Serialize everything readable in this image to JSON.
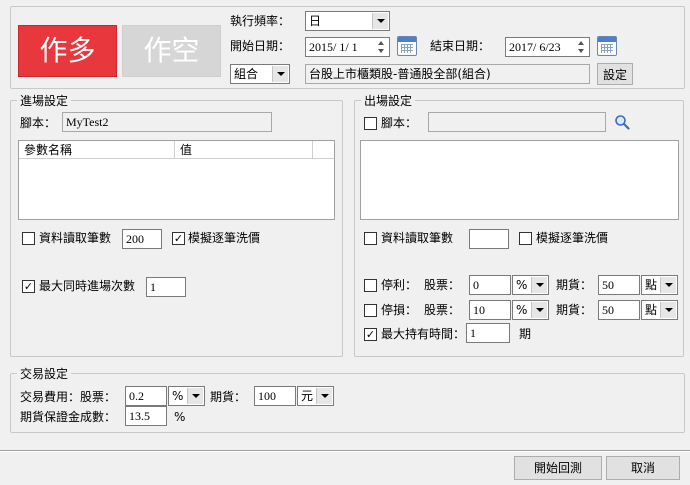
{
  "header": {
    "btn_long": "作多",
    "btn_short": "作空",
    "frequency_label": "執行頻率：",
    "frequency_value": "日",
    "start_label": "開始日期：",
    "start_value": "2015/ 1/ 1",
    "end_label": "結束日期：",
    "end_value": "2017/ 6/23",
    "scope_value": "組合",
    "scope_text": "台股上市櫃類股-普通股全部(組合)",
    "settings_btn": "設定"
  },
  "entry": {
    "title": "進場設定",
    "script_label": "腳本：",
    "script_value": "MyTest2",
    "param_col_name": "參數名稱",
    "param_col_value": "值",
    "records_label": "資料讀取筆數",
    "records_value": "200",
    "records_checked": false,
    "simulate_label": "模擬逐筆洗價",
    "simulate_checked": true,
    "max_entries_label": "最大同時進場次數",
    "max_entries_value": "1",
    "max_entries_checked": true
  },
  "exit": {
    "title": "出場設定",
    "script_label": "腳本：",
    "script_checked": false,
    "records_label": "資料讀取筆數",
    "records_checked": false,
    "simulate_label": "模擬逐筆洗價",
    "simulate_checked": false,
    "take_profit_label": "停利：",
    "take_profit_checked": false,
    "stop_loss_label": "停損：",
    "stop_loss_checked": false,
    "stock_label": "股票：",
    "futures_label": "期貨：",
    "tp_stock_value": "0",
    "tp_stock_unit": "%",
    "tp_fut_value": "50",
    "tp_fut_unit": "點",
    "sl_stock_value": "10",
    "sl_stock_unit": "%",
    "sl_fut_value": "50",
    "sl_fut_unit": "點",
    "max_hold_label": "最大持有時間：",
    "max_hold_checked": true,
    "max_hold_value": "1",
    "max_hold_unit": "期"
  },
  "trade": {
    "title": "交易設定",
    "fee_label": "交易費用：股票：",
    "fee_stock_value": "0.2",
    "fee_stock_unit": "%",
    "fee_fut_label": "期貨：",
    "fee_fut_value": "100",
    "fee_fut_unit": "元",
    "margin_label": "期貨保證金成數：",
    "margin_value": "13.5",
    "margin_unit": "%"
  },
  "footer": {
    "start_btn": "開始回測",
    "cancel_btn": "取消"
  },
  "colors": {
    "long_btn": "#e8383d",
    "short_btn": "#d6d6d6",
    "window_bg": "#f0f0f0"
  }
}
